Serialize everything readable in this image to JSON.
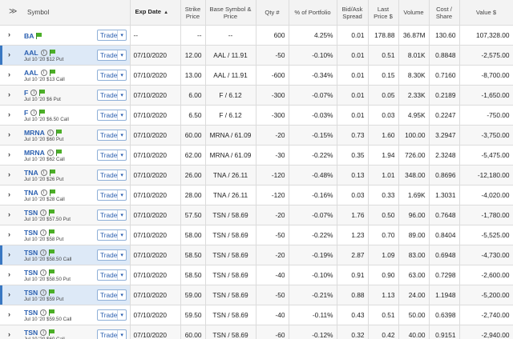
{
  "columns": {
    "expand_all": "≫",
    "symbol": "Symbol",
    "exp_date": "Exp Date",
    "sort_indicator": "▲",
    "strike": [
      "Strike",
      "Price"
    ],
    "base": [
      "Base Symbol &",
      "Price"
    ],
    "qty": "Qty #",
    "pct": "% of Portfolio",
    "spread": [
      "Bid/Ask",
      "Spread"
    ],
    "last": [
      "Last",
      "Price $"
    ],
    "volume": "Volume",
    "cost": [
      "Cost /",
      "Share"
    ],
    "value": "Value $"
  },
  "trade_label": "Trade",
  "icons": {
    "expand": "chevron-right-icon",
    "info": "info-icon",
    "flag": "green-flag-icon",
    "dropdown": "chevron-down-icon"
  },
  "colors": {
    "ticker": "#2a5fb0",
    "selected_row": "#dde9f7",
    "flag": "#4caf28"
  },
  "rows": [
    {
      "ticker": "BA",
      "desc": "",
      "exp": "--",
      "strike": "--",
      "base": "--",
      "qty": "600",
      "pct": "4.25%",
      "spread": "0.01",
      "last": "178.88",
      "volume": "36.87M",
      "cost": "130.60",
      "value": "107,328.00",
      "selected": false,
      "info": false
    },
    {
      "ticker": "AAL",
      "desc": "Jul 10 '20 $12 Put",
      "exp": "07/10/2020",
      "strike": "12.00",
      "base": "AAL / 11.91",
      "qty": "-50",
      "pct": "-0.10%",
      "spread": "0.01",
      "last": "0.51",
      "volume": "8.01K",
      "cost": "0.8848",
      "value": "-2,575.00",
      "selected": true,
      "info": true
    },
    {
      "ticker": "AAL",
      "desc": "Jul 10 '20 $13 Call",
      "exp": "07/10/2020",
      "strike": "13.00",
      "base": "AAL / 11.91",
      "qty": "-600",
      "pct": "-0.34%",
      "spread": "0.01",
      "last": "0.15",
      "volume": "8.30K",
      "cost": "0.7160",
      "value": "-8,700.00",
      "selected": false,
      "info": true
    },
    {
      "ticker": "F",
      "desc": "Jul 10 '20 $6 Put",
      "exp": "07/10/2020",
      "strike": "6.00",
      "base": "F / 6.12",
      "qty": "-300",
      "pct": "-0.07%",
      "spread": "0.01",
      "last": "0.05",
      "volume": "2.33K",
      "cost": "0.2189",
      "value": "-1,650.00",
      "selected": false,
      "info": true
    },
    {
      "ticker": "F",
      "desc": "Jul 10 '20 $6.50 Call",
      "exp": "07/10/2020",
      "strike": "6.50",
      "base": "F / 6.12",
      "qty": "-300",
      "pct": "-0.03%",
      "spread": "0.01",
      "last": "0.03",
      "volume": "4.95K",
      "cost": "0.2247",
      "value": "-750.00",
      "selected": false,
      "info": true
    },
    {
      "ticker": "MRNA",
      "desc": "Jul 10 '20 $60 Put",
      "exp": "07/10/2020",
      "strike": "60.00",
      "base": "MRNA / 61.09",
      "qty": "-20",
      "pct": "-0.15%",
      "spread": "0.73",
      "last": "1.60",
      "volume": "100.00",
      "cost": "3.2947",
      "value": "-3,750.00",
      "selected": false,
      "info": true
    },
    {
      "ticker": "MRNA",
      "desc": "Jul 10 '20 $62 Call",
      "exp": "07/10/2020",
      "strike": "62.00",
      "base": "MRNA / 61.09",
      "qty": "-30",
      "pct": "-0.22%",
      "spread": "0.35",
      "last": "1.94",
      "volume": "726.00",
      "cost": "2.3248",
      "value": "-5,475.00",
      "selected": false,
      "info": true
    },
    {
      "ticker": "TNA",
      "desc": "Jul 10 '20 $26 Put",
      "exp": "07/10/2020",
      "strike": "26.00",
      "base": "TNA / 26.11",
      "qty": "-120",
      "pct": "-0.48%",
      "spread": "0.13",
      "last": "1.01",
      "volume": "348.00",
      "cost": "0.8696",
      "value": "-12,180.00",
      "selected": false,
      "info": true
    },
    {
      "ticker": "TNA",
      "desc": "Jul 10 '20 $28 Call",
      "exp": "07/10/2020",
      "strike": "28.00",
      "base": "TNA / 26.11",
      "qty": "-120",
      "pct": "-0.16%",
      "spread": "0.03",
      "last": "0.33",
      "volume": "1.69K",
      "cost": "1.3031",
      "value": "-4,020.00",
      "selected": false,
      "info": true
    },
    {
      "ticker": "TSN",
      "desc": "Jul 10 '20 $57.50 Put",
      "exp": "07/10/2020",
      "strike": "57.50",
      "base": "TSN / 58.69",
      "qty": "-20",
      "pct": "-0.07%",
      "spread": "1.76",
      "last": "0.50",
      "volume": "96.00",
      "cost": "0.7648",
      "value": "-1,780.00",
      "selected": false,
      "info": true
    },
    {
      "ticker": "TSN",
      "desc": "Jul 10 '20 $58 Put",
      "exp": "07/10/2020",
      "strike": "58.00",
      "base": "TSN / 58.69",
      "qty": "-50",
      "pct": "-0.22%",
      "spread": "1.23",
      "last": "0.70",
      "volume": "89.00",
      "cost": "0.8404",
      "value": "-5,525.00",
      "selected": false,
      "info": true
    },
    {
      "ticker": "TSN",
      "desc": "Jul 10 '20 $58.50 Call",
      "exp": "07/10/2020",
      "strike": "58.50",
      "base": "TSN / 58.69",
      "qty": "-20",
      "pct": "-0.19%",
      "spread": "2.87",
      "last": "1.09",
      "volume": "83.00",
      "cost": "0.6948",
      "value": "-4,730.00",
      "selected": true,
      "info": true
    },
    {
      "ticker": "TSN",
      "desc": "Jul 10 '20 $58.50 Put",
      "exp": "07/10/2020",
      "strike": "58.50",
      "base": "TSN / 58.69",
      "qty": "-40",
      "pct": "-0.10%",
      "spread": "0.91",
      "last": "0.90",
      "volume": "63.00",
      "cost": "0.7298",
      "value": "-2,600.00",
      "selected": false,
      "info": true
    },
    {
      "ticker": "TSN",
      "desc": "Jul 10 '20 $59 Put",
      "exp": "07/10/2020",
      "strike": "59.00",
      "base": "TSN / 58.69",
      "qty": "-50",
      "pct": "-0.21%",
      "spread": "0.88",
      "last": "1.13",
      "volume": "24.00",
      "cost": "1.1948",
      "value": "-5,200.00",
      "selected": true,
      "info": true
    },
    {
      "ticker": "TSN",
      "desc": "Jul 10 '20 $59.50 Call",
      "exp": "07/10/2020",
      "strike": "59.50",
      "base": "TSN / 58.69",
      "qty": "-40",
      "pct": "-0.11%",
      "spread": "0.43",
      "last": "0.51",
      "volume": "50.00",
      "cost": "0.6398",
      "value": "-2,740.00",
      "selected": false,
      "info": true
    },
    {
      "ticker": "TSN",
      "desc": "Jul 10 '20 $60 Call",
      "exp": "07/10/2020",
      "strike": "60.00",
      "base": "TSN / 58.69",
      "qty": "-60",
      "pct": "-0.12%",
      "spread": "0.32",
      "last": "0.42",
      "volume": "40.00",
      "cost": "0.9151",
      "value": "-2,940.00",
      "selected": false,
      "info": true
    }
  ]
}
